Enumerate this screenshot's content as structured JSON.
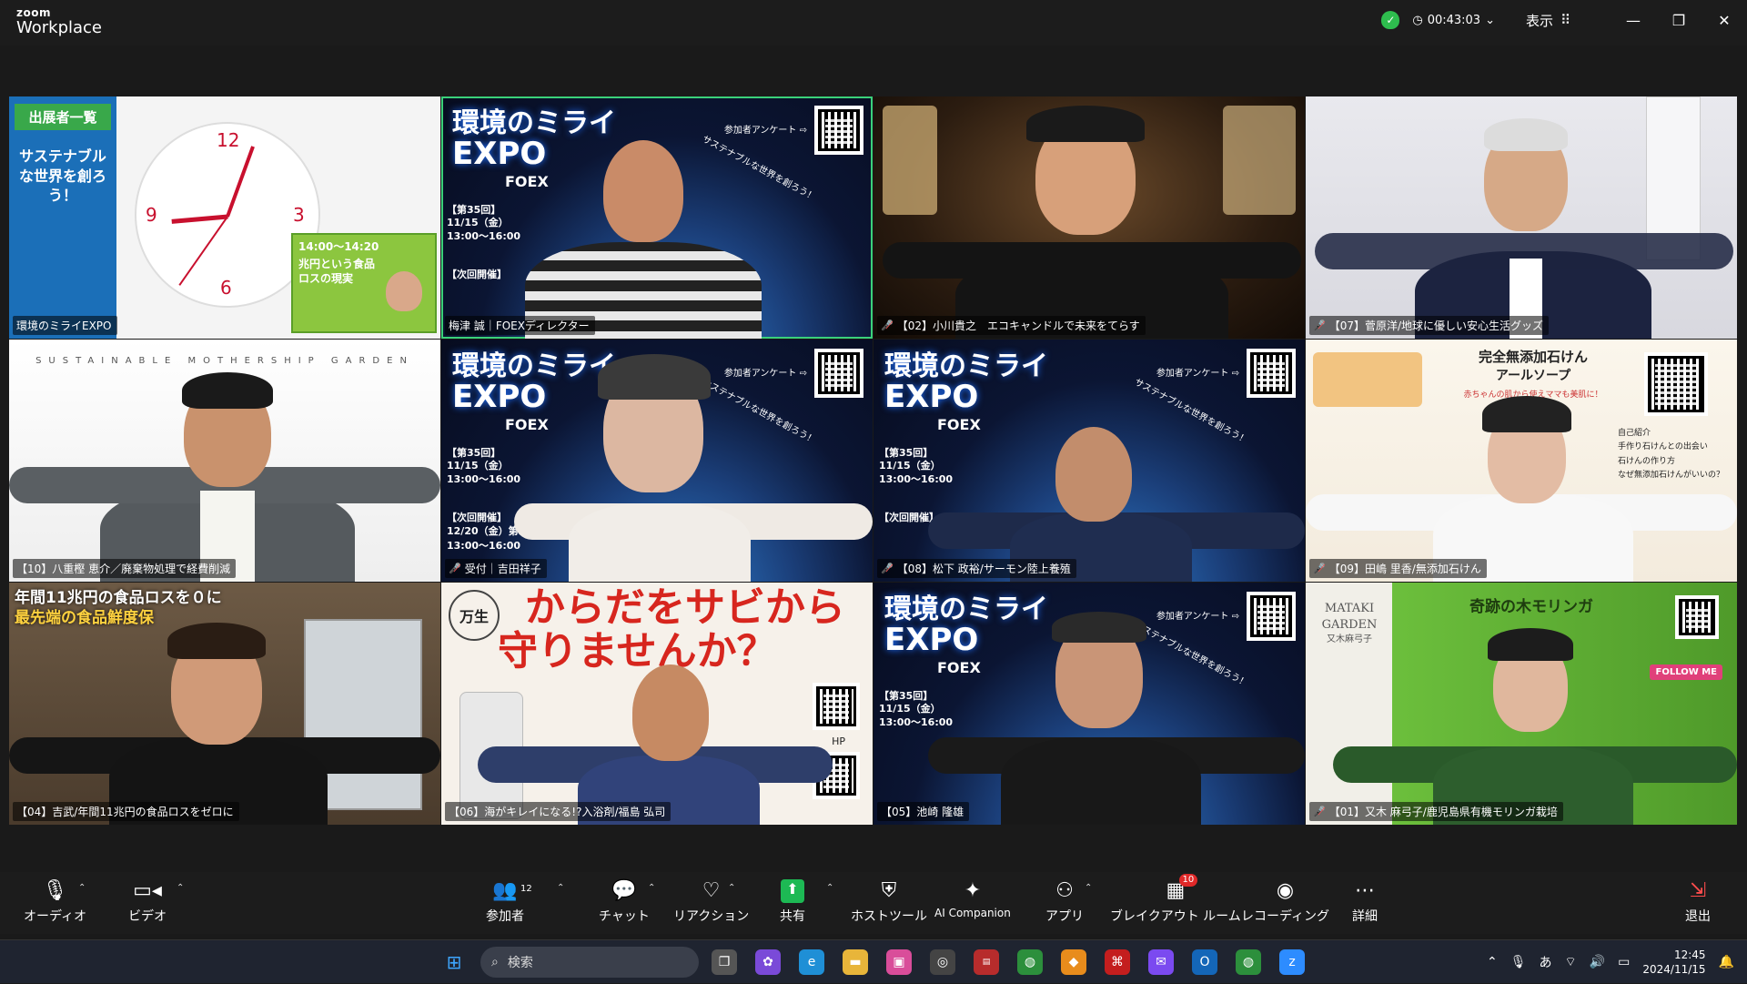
{
  "app": {
    "brand_top": "zoom",
    "brand_bottom": "Workplace",
    "timer": "00:43:03",
    "view_label": "表示"
  },
  "tiles": [
    {
      "name": "環境のミライEXPO",
      "muted": false
    },
    {
      "name": "梅津 誠｜FOEXディレクター",
      "muted": false,
      "active": true
    },
    {
      "name": "【02】小川貴之　エコキャンドルで未来をてらす",
      "muted": true
    },
    {
      "name": "【07】菅原洋/地球に優しい安心生活グッズ",
      "muted": true
    },
    {
      "name": "【10】八重樫 恵介／廃棄物処理で経費削減",
      "muted": false
    },
    {
      "name": "受付｜吉田祥子",
      "muted": true
    },
    {
      "name": "【08】松下 政裕/サーモン陸上養殖",
      "muted": true
    },
    {
      "name": "【09】田嶋 里香/無添加石けん",
      "muted": true
    },
    {
      "name": "【04】吉武/年間11兆円の食品ロスをゼロに",
      "muted": false
    },
    {
      "name": "【06】海がキレイになる!?入浴剤/福島 弘司",
      "muted": false
    },
    {
      "name": "【05】池崎 隆雄",
      "muted": false
    },
    {
      "name": "【01】又木 麻弓子/鹿児島県有機モリンガ栽培",
      "muted": true
    }
  ],
  "slides": {
    "exhibitors": "出展者一覧",
    "sustainable": "サステナブルな世界を創ろう！",
    "expo_title1": "環境のミライ",
    "expo_title2": "EXPO",
    "foex": "FOEX",
    "session": "【第35回】",
    "date1": "11/15（金）",
    "time1": "13:00〜16:00",
    "next_label": "【次回開催】",
    "next_date": "12/20（金）第3金曜日",
    "next_time": "13:00〜16:00",
    "survey": "参加者アンケート ⇨",
    "slogan": "サステナブルな世界を創ろう！",
    "mothership": "SUSTAINABLE MOTHERSHIP GARDEN",
    "soap_title": "完全無添加石けん",
    "soap_sub": "アールソープ",
    "soap_caption": "赤ちゃんの肌から使えママも美肌に！",
    "soap_items": [
      "自己紹介",
      "手作り石けんとの出会い",
      "石けんの作り方",
      "なぜ無添加石けんがいいの？"
    ],
    "foodloss": "年間11兆円の食品ロスを０に",
    "foodloss2": "最先端の食品鮮度保",
    "rust1": "からだをサビから",
    "rust2": "守りませんか？",
    "mangen": "万生",
    "hp": "HP",
    "mataki1": "MATAKI",
    "mataki2": "GARDEN",
    "mataki3": "又木麻弓子",
    "moringa": "奇跡の木モリンガ",
    "follow": "FOLLOW ME",
    "loss_tile": "兆円という食品ロスの現実",
    "time_tile": "14:00〜14:20"
  },
  "toolbar": {
    "audio": "オーディオ",
    "video": "ビデオ",
    "participants": "参加者",
    "participants_count": "12",
    "chat": "チャット",
    "reactions": "リアクション",
    "share": "共有",
    "host_tools": "ホストツール",
    "ai_companion": "AI Companion",
    "apps": "アプリ",
    "breakout": "ブレイクアウト ルーム",
    "breakout_badge": "10",
    "recording": "レコーディング",
    "more": "詳細",
    "leave": "退出"
  },
  "taskbar": {
    "search": "検索",
    "ime": "あ",
    "time": "12:45",
    "date": "2024/11/15"
  },
  "colors": {
    "active_border": "#3ad17a",
    "share_green": "#1db954",
    "badge_red": "#e02828",
    "mute_red": "#ff4d4d"
  }
}
